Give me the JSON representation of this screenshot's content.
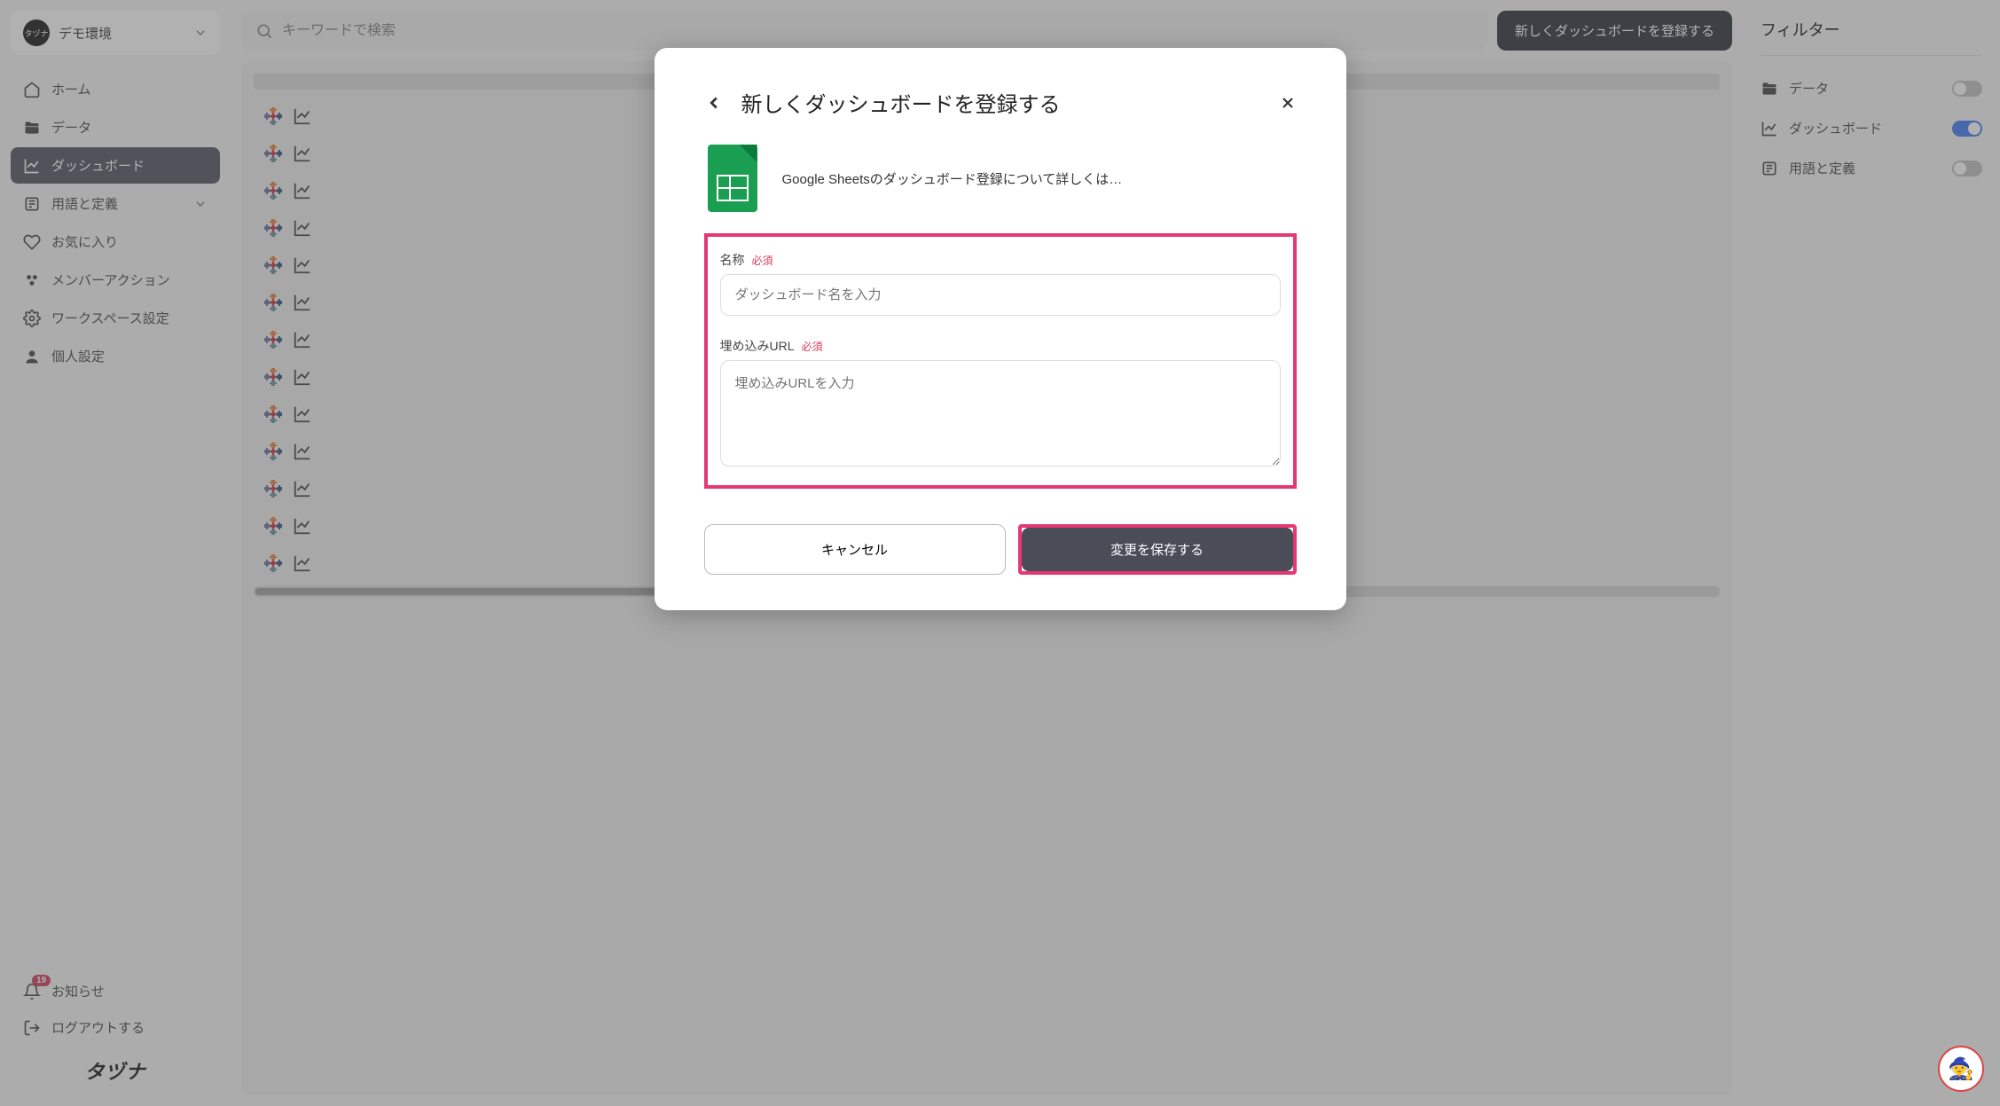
{
  "env": {
    "name": "デモ環境",
    "logo_text": "タヅナ"
  },
  "sidebar": {
    "items": [
      {
        "label": "ホーム",
        "icon": "home"
      },
      {
        "label": "データ",
        "icon": "folder"
      },
      {
        "label": "ダッシュボード",
        "icon": "chart",
        "active": true
      },
      {
        "label": "用語と定義",
        "icon": "book",
        "expandable": true
      },
      {
        "label": "お気に入り",
        "icon": "heart"
      },
      {
        "label": "メンバーアクション",
        "icon": "members"
      },
      {
        "label": "ワークスペース設定",
        "icon": "gear"
      },
      {
        "label": "個人設定",
        "icon": "person"
      }
    ],
    "notifications": {
      "label": "お知らせ",
      "count": "19"
    },
    "logout": {
      "label": "ログアウトする"
    },
    "brand": "タヅナ"
  },
  "topbar": {
    "search_placeholder": "キーワードで検索",
    "register_button": "新しくダッシュボードを登録する"
  },
  "filter": {
    "title": "フィルター",
    "items": [
      {
        "label": "データ",
        "icon": "folder",
        "on": false
      },
      {
        "label": "ダッシュボード",
        "icon": "chart",
        "on": true
      },
      {
        "label": "用語と定義",
        "icon": "book",
        "on": false
      }
    ]
  },
  "modal": {
    "title": "新しくダッシュボードを登録する",
    "info_text": "Google Sheetsのダッシュボード登録について詳しくは…",
    "name_label": "名称",
    "required_tag": "必須",
    "name_placeholder": "ダッシュボード名を入力",
    "url_label": "埋め込みURL",
    "url_placeholder": "埋め込みURLを入力",
    "cancel": "キャンセル",
    "save": "変更を保存する"
  },
  "list_row_count": 13
}
